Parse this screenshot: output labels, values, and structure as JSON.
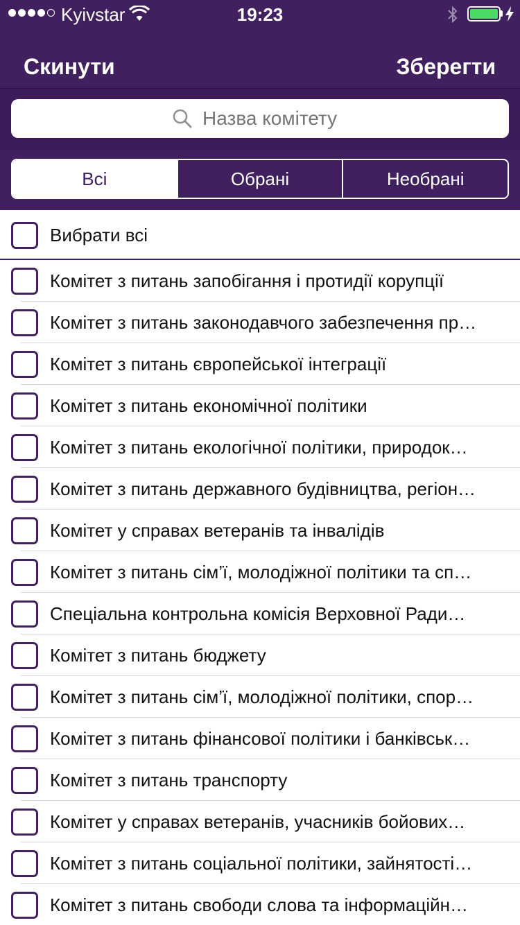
{
  "status_bar": {
    "carrier": "Kyivstar",
    "time": "19:23",
    "battery_color": "#4cd964"
  },
  "nav": {
    "reset_label": "Скинути",
    "save_label": "Зберегти"
  },
  "search": {
    "placeholder": "Назва комітету",
    "value": ""
  },
  "filter_tabs": [
    {
      "label": "Всі",
      "selected": true
    },
    {
      "label": "Обрані",
      "selected": false
    },
    {
      "label": "Необрані",
      "selected": false
    }
  ],
  "select_all": {
    "label": "Вибрати всі",
    "checked": false
  },
  "committees": [
    {
      "label": "Комітет з питань запобігання і протидії корупції",
      "checked": false
    },
    {
      "label": "Комітет з питань законодавчого забезпечення пр…",
      "checked": false
    },
    {
      "label": "Комітет з питань європейської інтеграції",
      "checked": false
    },
    {
      "label": "Комітет з питань економічної політики",
      "checked": false
    },
    {
      "label": "Комітет з питань екологічної політики, природок…",
      "checked": false
    },
    {
      "label": "Комітет з питань державного будівництва, регіон…",
      "checked": false
    },
    {
      "label": "Комітет у справах ветеранів та інвалідів",
      "checked": false
    },
    {
      "label": "Комітет з питань сім’ї, молодіжної політики та сп…",
      "checked": false
    },
    {
      "label": "Спеціальна контрольна комісія Верховної Ради…",
      "checked": false
    },
    {
      "label": "Комітет з питань бюджету",
      "checked": false
    },
    {
      "label": "Комітет з питань сім’ї, молодіжної політики, спор…",
      "checked": false
    },
    {
      "label": "Комітет з питань фінансової політики і банківськ…",
      "checked": false
    },
    {
      "label": "Комітет з питань транспорту",
      "checked": false
    },
    {
      "label": "Комітет у справах ветеранів, учасників бойових…",
      "checked": false
    },
    {
      "label": "Комітет з питань соціальної політики, зайнятості…",
      "checked": false
    },
    {
      "label": "Комітет з питань свободи слова та інформаційн…",
      "checked": false
    }
  ],
  "colors": {
    "primary": "#40205e",
    "search_background": "#3b1b58",
    "separator": "#d9d9d9"
  }
}
